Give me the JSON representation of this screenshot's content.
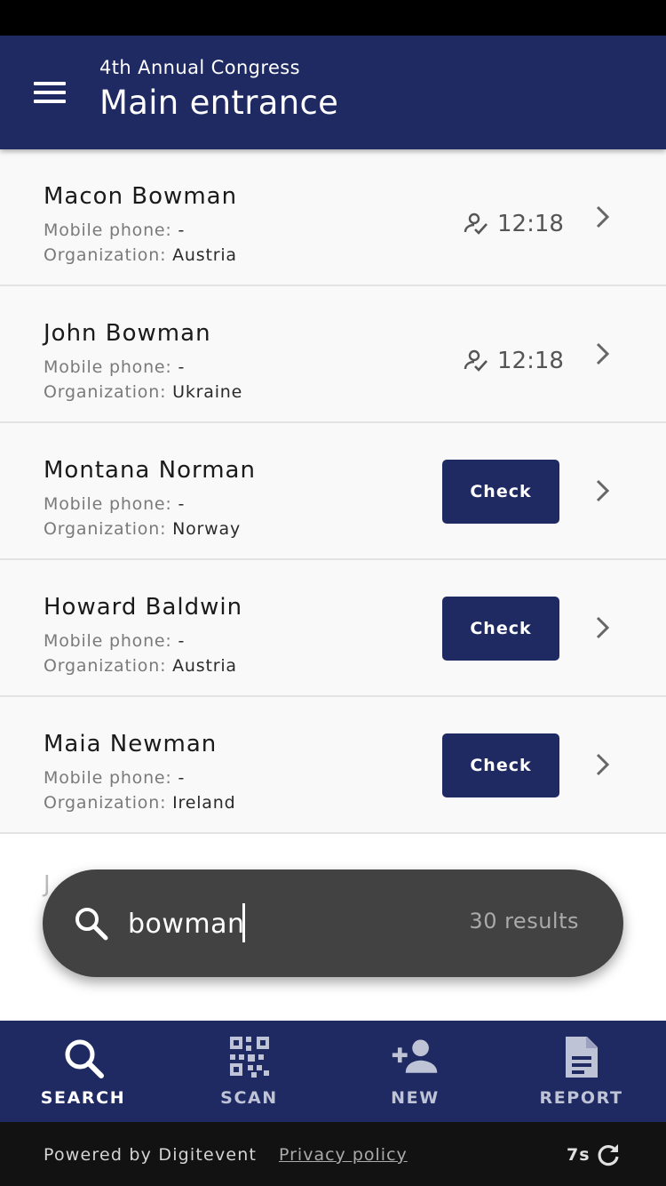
{
  "header": {
    "subtitle": "4th Annual Congress",
    "title": "Main entrance"
  },
  "attendees": [
    {
      "name": "Macon Bowman",
      "phone_label": "Mobile phone:",
      "phone": "-",
      "org_label": "Organization:",
      "org": "Austria",
      "checked_in_time": "12:18"
    },
    {
      "name": "John Bowman",
      "phone_label": "Mobile phone:",
      "phone": "-",
      "org_label": "Organization:",
      "org": "Ukraine",
      "checked_in_time": "12:18"
    },
    {
      "name": "Montana Norman",
      "phone_label": "Mobile phone:",
      "phone": "-",
      "org_label": "Organization:",
      "org": "Norway",
      "check_label": "Check"
    },
    {
      "name": "Howard Baldwin",
      "phone_label": "Mobile phone:",
      "phone": "-",
      "org_label": "Organization:",
      "org": "Austria",
      "check_label": "Check"
    },
    {
      "name": "Maia Newman",
      "phone_label": "Mobile phone:",
      "phone": "-",
      "org_label": "Organization:",
      "org": "Ireland",
      "check_label": "Check"
    }
  ],
  "partial_row": {
    "initial": "J"
  },
  "search": {
    "value": "bowman",
    "results": "30 results"
  },
  "nav": [
    {
      "label": "SEARCH",
      "icon": "search-icon",
      "active": true
    },
    {
      "label": "SCAN",
      "icon": "qr-code-icon",
      "active": false
    },
    {
      "label": "NEW",
      "icon": "add-person-icon",
      "active": false
    },
    {
      "label": "REPORT",
      "icon": "document-icon",
      "active": false
    }
  ],
  "footer": {
    "powered_by": "Powered by Digitevent",
    "privacy": "Privacy policy",
    "timer": "7s"
  },
  "colors": {
    "primary": "#1f2a63",
    "search_bg": "#424242",
    "footer_bg": "#121212"
  }
}
